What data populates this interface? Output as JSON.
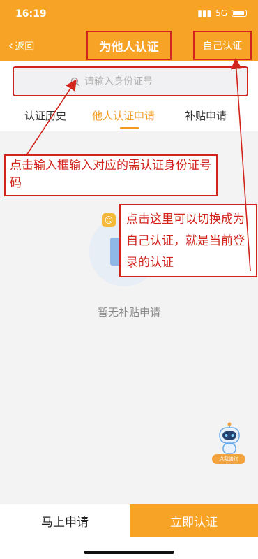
{
  "status": {
    "time": "16:19",
    "network": "5G"
  },
  "nav": {
    "back_label": "返回",
    "title": "为他人认证",
    "self_verify_label": "自己认证"
  },
  "search": {
    "placeholder": "请输入身份证号"
  },
  "tabs": [
    {
      "label": "认证历史",
      "active": false
    },
    {
      "label": "他人认证申请",
      "active": true
    },
    {
      "label": "补贴申请",
      "active": false
    }
  ],
  "annotations": {
    "input_note": "点击输入框输入对应的需认证身份证号码",
    "switch_note": "点击这里可以切换成为自己认证，就是当前登录的认证"
  },
  "empty_state": {
    "text": "暂无补贴申请"
  },
  "robot": {
    "label": "点我咨询"
  },
  "bottom": {
    "apply_label": "马上申请",
    "verify_label": "立即认证"
  },
  "colors": {
    "primary": "#f7a325",
    "annotation": "#d0241c",
    "tab_active": "#f39a1e"
  }
}
